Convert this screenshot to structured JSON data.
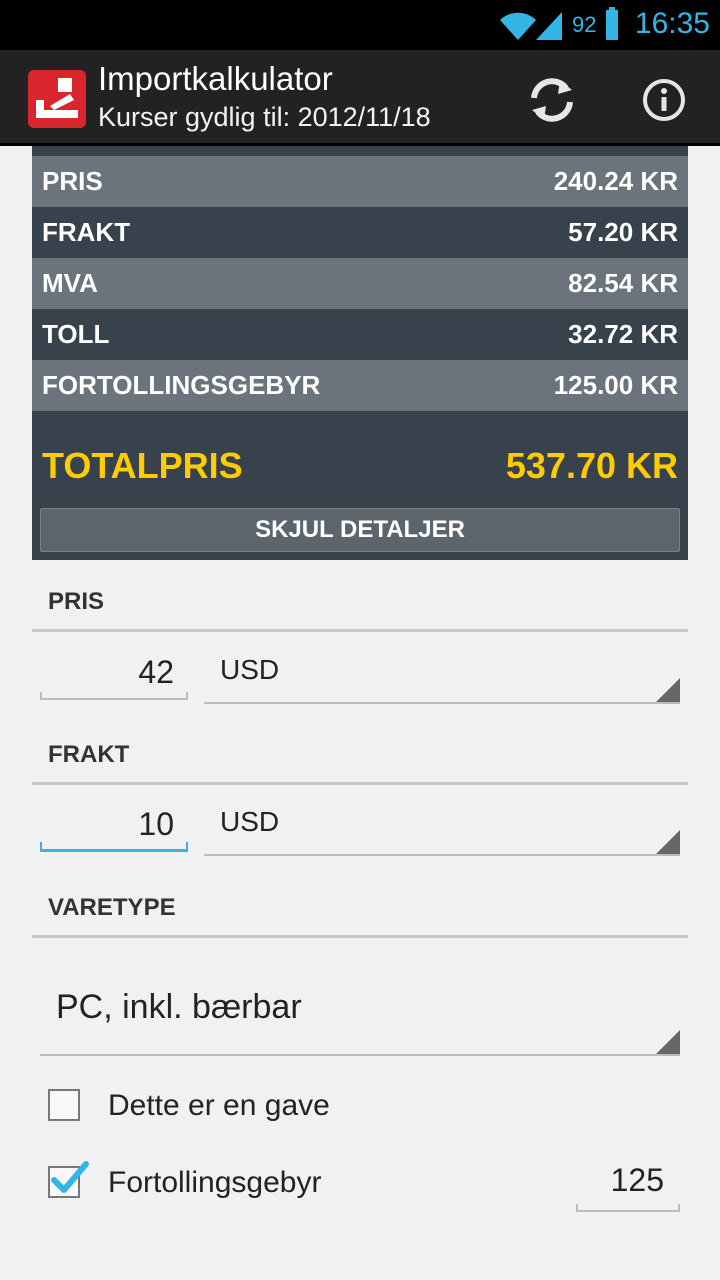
{
  "status_bar": {
    "battery_percent": "92",
    "time": "16:35",
    "icons": [
      "wifi-icon",
      "signal-icon",
      "battery-icon"
    ]
  },
  "action_bar": {
    "title": "Importkalkulator",
    "subtitle": "Kurser gydlig til: 2012/11/18",
    "icons": [
      "app-logo-icon",
      "refresh-icon",
      "info-icon"
    ]
  },
  "summary": {
    "rows": [
      {
        "label": "PRIS",
        "value": "240.24 KR"
      },
      {
        "label": "FRAKT",
        "value": "57.20 KR"
      },
      {
        "label": "MVA",
        "value": "82.54 KR"
      },
      {
        "label": "TOLL",
        "value": "32.72 KR"
      },
      {
        "label": "FORTOLLINGSGEBYR",
        "value": "125.00 KR"
      }
    ],
    "total_label": "TOTALPRIS",
    "total_value": "537.70 KR",
    "hide_button": "SKJUL DETALJER"
  },
  "form": {
    "pris": {
      "header": "PRIS",
      "amount": "42",
      "currency": "USD"
    },
    "frakt": {
      "header": "FRAKT",
      "amount": "10",
      "currency": "USD"
    },
    "varetype": {
      "header": "VARETYPE",
      "selected": "PC, inkl. bærbar"
    },
    "gift": {
      "label": "Dette er en gave",
      "checked": false
    },
    "fee": {
      "label": "Fortollingsgebyr",
      "checked": true,
      "amount": "125"
    }
  },
  "colors": {
    "accent": "#33b5e5",
    "total": "#ffcc00",
    "panel_dark": "#37424c",
    "panel_light": "#6b747c",
    "app_icon": "#d9262c"
  }
}
